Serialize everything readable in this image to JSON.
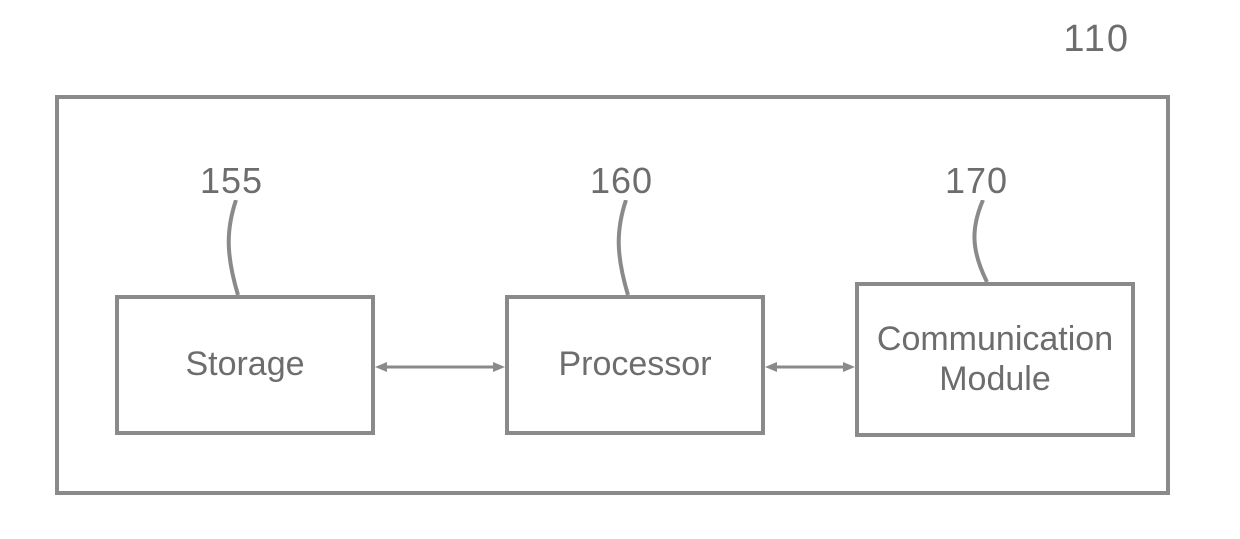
{
  "diagram": {
    "outer_ref": "110",
    "blocks": {
      "storage": {
        "ref": "155",
        "label": "Storage"
      },
      "processor": {
        "ref": "160",
        "label": "Processor"
      },
      "comm": {
        "ref": "170",
        "label": "Communication\nModule"
      }
    }
  }
}
